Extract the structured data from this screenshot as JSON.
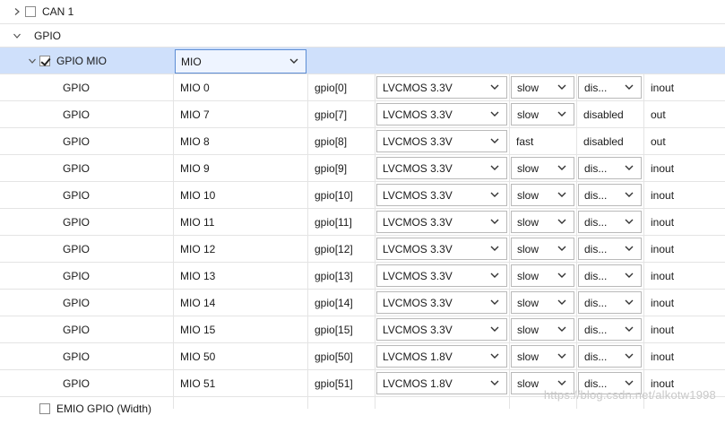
{
  "tree": {
    "can1_label": "CAN 1",
    "gpio_label": "GPIO",
    "gpio_mio_label": "GPIO MIO",
    "gpio_mio_value": "MIO",
    "emio_label": "EMIO GPIO (Width)"
  },
  "rows": [
    {
      "peripheral": "GPIO",
      "mio": "MIO 0",
      "signal": "gpio[0]",
      "io_type": "LVCMOS 3.3V",
      "speed": "slow",
      "speed_dropdown": true,
      "pullup": "dis...",
      "pullup_dropdown": true,
      "direction": "inout"
    },
    {
      "peripheral": "GPIO",
      "mio": "MIO 7",
      "signal": "gpio[7]",
      "io_type": "LVCMOS 3.3V",
      "speed": "slow",
      "speed_dropdown": true,
      "pullup": "disabled",
      "pullup_dropdown": false,
      "direction": "out"
    },
    {
      "peripheral": "GPIO",
      "mio": "MIO 8",
      "signal": "gpio[8]",
      "io_type": "LVCMOS 3.3V",
      "speed": "fast",
      "speed_dropdown": false,
      "pullup": "disabled",
      "pullup_dropdown": false,
      "direction": "out"
    },
    {
      "peripheral": "GPIO",
      "mio": "MIO 9",
      "signal": "gpio[9]",
      "io_type": "LVCMOS 3.3V",
      "speed": "slow",
      "speed_dropdown": true,
      "pullup": "dis...",
      "pullup_dropdown": true,
      "direction": "inout"
    },
    {
      "peripheral": "GPIO",
      "mio": "MIO 10",
      "signal": "gpio[10]",
      "io_type": "LVCMOS 3.3V",
      "speed": "slow",
      "speed_dropdown": true,
      "pullup": "dis...",
      "pullup_dropdown": true,
      "direction": "inout"
    },
    {
      "peripheral": "GPIO",
      "mio": "MIO 11",
      "signal": "gpio[11]",
      "io_type": "LVCMOS 3.3V",
      "speed": "slow",
      "speed_dropdown": true,
      "pullup": "dis...",
      "pullup_dropdown": true,
      "direction": "inout"
    },
    {
      "peripheral": "GPIO",
      "mio": "MIO 12",
      "signal": "gpio[12]",
      "io_type": "LVCMOS 3.3V",
      "speed": "slow",
      "speed_dropdown": true,
      "pullup": "dis...",
      "pullup_dropdown": true,
      "direction": "inout"
    },
    {
      "peripheral": "GPIO",
      "mio": "MIO 13",
      "signal": "gpio[13]",
      "io_type": "LVCMOS 3.3V",
      "speed": "slow",
      "speed_dropdown": true,
      "pullup": "dis...",
      "pullup_dropdown": true,
      "direction": "inout"
    },
    {
      "peripheral": "GPIO",
      "mio": "MIO 14",
      "signal": "gpio[14]",
      "io_type": "LVCMOS 3.3V",
      "speed": "slow",
      "speed_dropdown": true,
      "pullup": "dis...",
      "pullup_dropdown": true,
      "direction": "inout"
    },
    {
      "peripheral": "GPIO",
      "mio": "MIO 15",
      "signal": "gpio[15]",
      "io_type": "LVCMOS 3.3V",
      "speed": "slow",
      "speed_dropdown": true,
      "pullup": "dis...",
      "pullup_dropdown": true,
      "direction": "inout"
    },
    {
      "peripheral": "GPIO",
      "mio": "MIO 50",
      "signal": "gpio[50]",
      "io_type": "LVCMOS 1.8V",
      "speed": "slow",
      "speed_dropdown": true,
      "pullup": "dis...",
      "pullup_dropdown": true,
      "direction": "inout"
    },
    {
      "peripheral": "GPIO",
      "mio": "MIO 51",
      "signal": "gpio[51]",
      "io_type": "LVCMOS 1.8V",
      "speed": "slow",
      "speed_dropdown": true,
      "pullup": "dis...",
      "pullup_dropdown": true,
      "direction": "inout"
    }
  ],
  "watermark": "https://blog.csdn.net/alkotw1998",
  "colors": {
    "selected_row": "#cfe0fb",
    "grid": "#e4e4e4",
    "dropdown_border": "#b9b9b9"
  }
}
